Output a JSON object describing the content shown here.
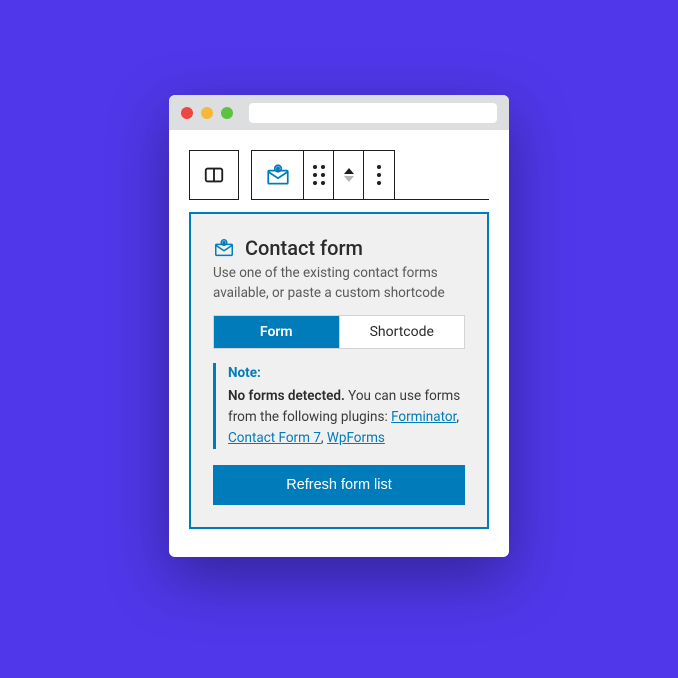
{
  "panel": {
    "title": "Contact form",
    "description": "Use one of the existing contact forms available, or paste a custom shortcode",
    "tabs": {
      "form": "Form",
      "shortcode": "Shortcode"
    },
    "note": {
      "title": "Note:",
      "lead": "No forms detected.",
      "body_pre": " You can use forms from the following plugins: ",
      "links": {
        "forminator": "Forminator",
        "cf7": "Contact Form 7",
        "wpforms": "WpForms"
      },
      "sep": ", "
    },
    "refresh": "Refresh form list"
  }
}
